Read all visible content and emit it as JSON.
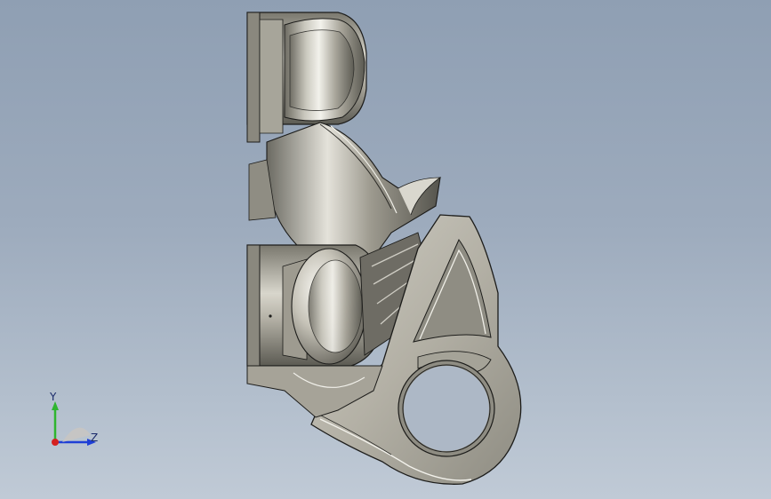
{
  "viewport": {
    "background_top": "#8f9fb3",
    "background_bottom": "#c0cad6"
  },
  "model": {
    "body_color": "#b8b5aa",
    "shadow_color": "#55544d",
    "highlight_color": "#f4f3ee",
    "edge_color": "#1c1c1a"
  },
  "triad": {
    "y_label": "Y",
    "z_label": "Z",
    "y_color": "#2fb52f",
    "z_color": "#1f3fd6",
    "x_color": "#d42020"
  }
}
